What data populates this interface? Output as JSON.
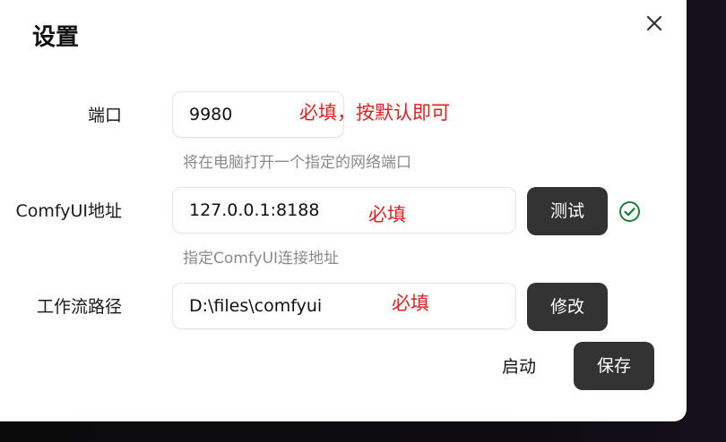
{
  "dialog": {
    "title": "设置",
    "close_icon": "close-icon"
  },
  "form": {
    "port": {
      "label": "端口",
      "value": "9980",
      "note": "必填，按默认即可",
      "hint": "将在电脑打开一个指定的网络端口"
    },
    "address": {
      "label": "ComfyUI地址",
      "value": "127.0.0.1:8188",
      "note": "必填",
      "test_button": "测试",
      "status_icon": "check-circle-icon",
      "hint": "指定ComfyUI连接地址"
    },
    "workflow": {
      "label": "工作流路径",
      "value": "D:\\files\\comfyui",
      "note": "必填",
      "modify_button": "修改"
    }
  },
  "footer": {
    "start_label": "启动",
    "save_label": "保存"
  },
  "colors": {
    "button_bg": "#333333",
    "note_red": "#e02020",
    "success_green": "#1a7f37"
  }
}
